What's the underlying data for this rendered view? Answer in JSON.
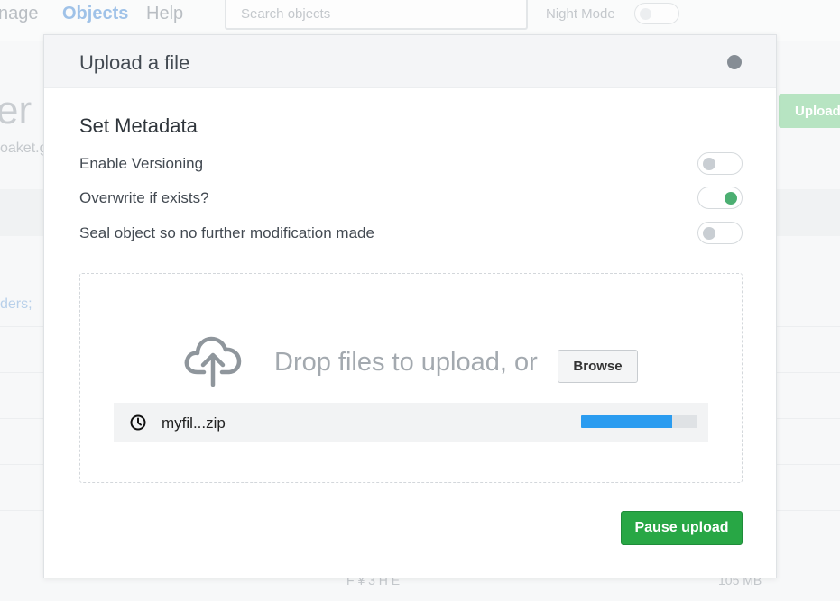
{
  "background": {
    "nav": {
      "manage_partial": "nage",
      "objects": "Objects",
      "help": "Help",
      "search_placeholder": "Search objects",
      "night_mode": "Night Mode"
    },
    "heading_partial": "er",
    "subtitle_partial": "oaket.g",
    "link_partial": "ders;",
    "upload_partial": "Upload",
    "bottom_partial_a": "F ¥ 3 H E",
    "bottom_partial_b": "105 MB"
  },
  "modal": {
    "title": "Upload a file",
    "section_title": "Set Metadata",
    "options": [
      {
        "label": "Enable Versioning",
        "enabled": false
      },
      {
        "label": "Overwrite if exists?",
        "enabled": true
      },
      {
        "label": "Seal object so no further modification made",
        "enabled": false
      }
    ],
    "dropzone": {
      "text": "Drop files to upload, or",
      "browse_label": "Browse",
      "icon": "cloud-upload-icon"
    },
    "file": {
      "name": "myfil...zip",
      "status_icon": "clock-icon",
      "progress": 0.78
    },
    "pause_label": "Pause upload"
  },
  "colors": {
    "accent_green": "#28a745",
    "toggle_on": "#4caf72",
    "progress": "#2b9cf0"
  }
}
